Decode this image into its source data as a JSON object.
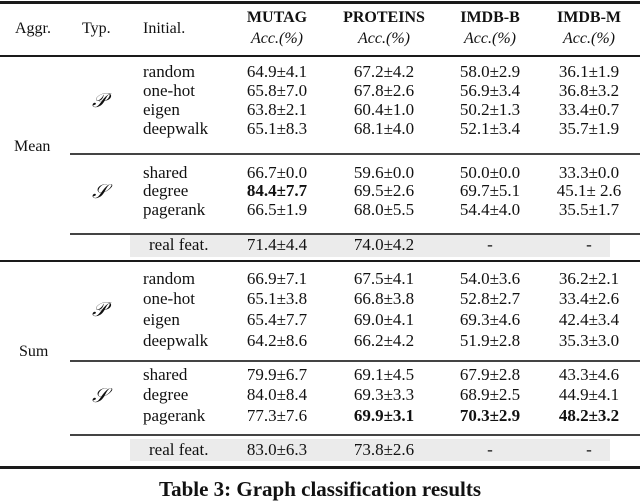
{
  "header": {
    "aggr": "Aggr.",
    "typ": "Typ.",
    "initial": "Initial.",
    "datasets": [
      {
        "name": "MUTAG",
        "metric": "Acc.(%)"
      },
      {
        "name": "PROTEINS",
        "metric": "Acc.(%)"
      },
      {
        "name": "IMDB-B",
        "metric": "Acc.(%)"
      },
      {
        "name": "IMDB-M",
        "metric": "Acc.(%)"
      }
    ]
  },
  "sections": [
    {
      "aggr": "Mean",
      "groups": [
        {
          "type_symbol": "𝒫",
          "rows": [
            {
              "init": "random",
              "values": [
                "64.9±4.1",
                "67.2±4.2",
                "58.0±2.9",
                "36.1±1.9"
              ],
              "bold": [
                false,
                false,
                false,
                false
              ]
            },
            {
              "init": "one-hot",
              "values": [
                "65.8±7.0",
                "67.8±2.6",
                "56.9±3.4",
                "36.8±3.2"
              ],
              "bold": [
                false,
                false,
                false,
                false
              ]
            },
            {
              "init": "eigen",
              "values": [
                "63.8±2.1",
                "60.4±1.0",
                "50.2±1.3",
                "33.4±0.7"
              ],
              "bold": [
                false,
                false,
                false,
                false
              ]
            },
            {
              "init": "deepwalk",
              "values": [
                "65.1±8.3",
                "68.1±4.0",
                "52.1±3.4",
                "35.7±1.9"
              ],
              "bold": [
                false,
                false,
                false,
                false
              ]
            }
          ]
        },
        {
          "type_symbol": "𝒮",
          "rows": [
            {
              "init": "shared",
              "values": [
                "66.7±0.0",
                "59.6±0.0",
                "50.0±0.0",
                "33.3±0.0"
              ],
              "bold": [
                false,
                false,
                false,
                false
              ]
            },
            {
              "init": "degree",
              "values": [
                "84.4±7.7",
                "69.5±2.6",
                "69.7±5.1",
                "45.1± 2.6"
              ],
              "bold": [
                true,
                false,
                false,
                false
              ]
            },
            {
              "init": "pagerank",
              "values": [
                "66.5±1.9",
                "68.0±5.5",
                "54.4±4.0",
                "35.5±1.7"
              ],
              "bold": [
                false,
                false,
                false,
                false
              ]
            }
          ]
        }
      ],
      "real": {
        "init": "real feat.",
        "values": [
          "71.4±4.4",
          "74.0±4.2",
          "-",
          "-"
        ]
      }
    },
    {
      "aggr": "Sum",
      "groups": [
        {
          "type_symbol": "𝒫",
          "rows": [
            {
              "init": "random",
              "values": [
                "66.9±7.1",
                "67.5±4.1",
                "54.0±3.6",
                "36.2±2.1"
              ],
              "bold": [
                false,
                false,
                false,
                false
              ]
            },
            {
              "init": "one-hot",
              "values": [
                "65.1±3.8",
                "66.8±3.8",
                "52.8±2.7",
                "33.4±2.6"
              ],
              "bold": [
                false,
                false,
                false,
                false
              ]
            },
            {
              "init": "eigen",
              "values": [
                "65.4±7.7",
                "69.0±4.1",
                "69.3±4.6",
                "42.4±3.4"
              ],
              "bold": [
                false,
                false,
                false,
                false
              ]
            },
            {
              "init": "deepwalk",
              "values": [
                "64.2±8.6",
                "66.2±4.2",
                "51.9±2.8",
                "35.3±3.0"
              ],
              "bold": [
                false,
                false,
                false,
                false
              ]
            }
          ]
        },
        {
          "type_symbol": "𝒮",
          "rows": [
            {
              "init": "shared",
              "values": [
                "79.9±6.7",
                "69.1±4.5",
                "67.9±2.8",
                "43.3±4.6"
              ],
              "bold": [
                false,
                false,
                false,
                false
              ]
            },
            {
              "init": "degree",
              "values": [
                "84.0±8.4",
                "69.3±3.3",
                "68.9±2.5",
                "44.9±4.1"
              ],
              "bold": [
                false,
                false,
                false,
                false
              ]
            },
            {
              "init": "pagerank",
              "values": [
                "77.3±7.6",
                "69.9±3.1",
                "70.3±2.9",
                "48.2±3.2"
              ],
              "bold": [
                false,
                true,
                true,
                true
              ]
            }
          ]
        }
      ],
      "real": {
        "init": "real feat.",
        "values": [
          "83.0±6.3",
          "73.8±2.6",
          "-",
          "-"
        ]
      }
    }
  ],
  "caption": "Table 3: Graph classification results"
}
